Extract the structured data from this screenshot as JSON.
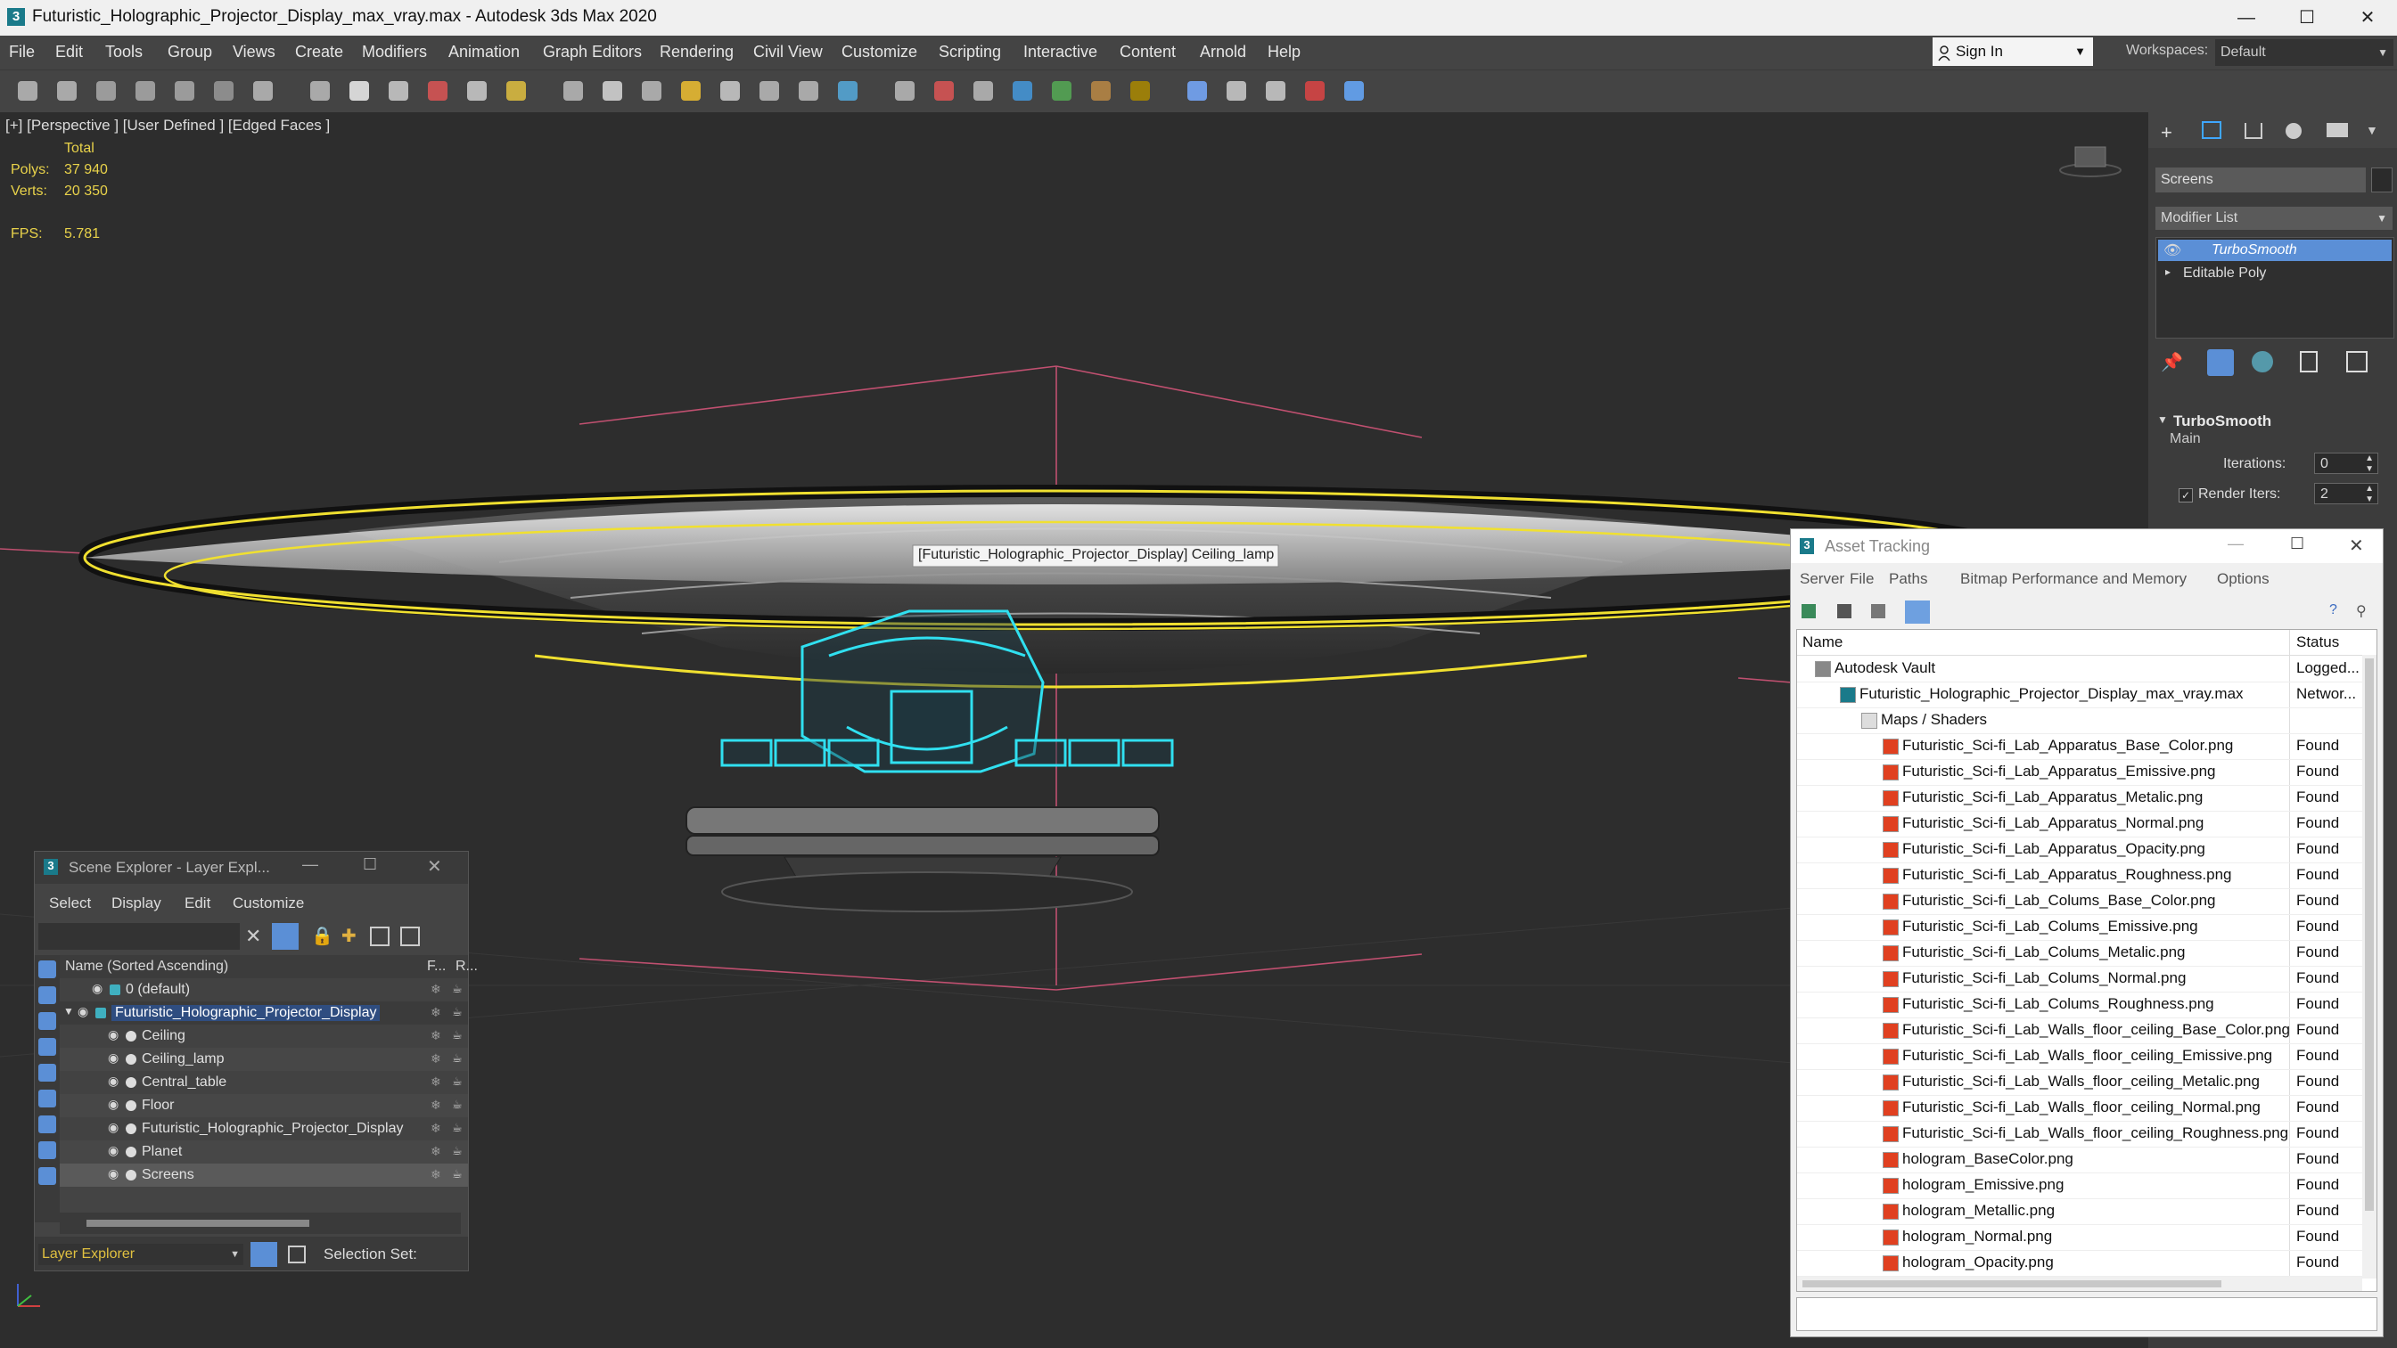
{
  "window": {
    "title": "Futuristic_Holographic_Projector_Display_max_vray.max - Autodesk 3ds Max 2020",
    "app_icon": "3",
    "minimize": "—",
    "maximize": "☐",
    "close": "✕"
  },
  "menu": [
    "File",
    "Edit",
    "Tools",
    "Group",
    "Views",
    "Create",
    "Modifiers",
    "Animation",
    "Graph Editors",
    "Rendering",
    "Civil View",
    "Customize",
    "Scripting",
    "Interactive",
    "Content",
    "Arnold",
    "Help"
  ],
  "signin": {
    "label": "Sign In"
  },
  "workspace": {
    "label": "Workspaces:",
    "value": "Default"
  },
  "viewport": {
    "label": "[+] [Perspective ] [User Defined ] [Edged Faces ]",
    "stats": {
      "total_label": "Total",
      "polys_label": "Polys:",
      "polys": "37 940",
      "verts_label": "Verts:",
      "verts": "20 350",
      "fps_label": "FPS:",
      "fps": "5.781"
    },
    "tooltip": "[Futuristic_Holographic_Projector_Display] Ceiling_lamp"
  },
  "command_panel": {
    "object_name": "Screens",
    "modifier_list": "Modifier List",
    "stack": [
      "TurboSmooth",
      "Editable Poly"
    ],
    "rollout_title": "TurboSmooth",
    "section": "Main",
    "iterations_label": "Iterations:",
    "iterations": "0",
    "render_iters_label": "Render Iters:",
    "render_iters": "2"
  },
  "scene_explorer": {
    "title": "Scene Explorer - Layer Expl...",
    "menu": [
      "Select",
      "Display",
      "Edit",
      "Customize"
    ],
    "col_name": "Name (Sorted Ascending)",
    "col_f": "F...",
    "col_r": "R...",
    "rows": [
      {
        "label": "0 (default)",
        "indent": 1
      },
      {
        "label": "Futuristic_Holographic_Projector_Display",
        "indent": 0,
        "selected": true
      },
      {
        "label": "Ceiling",
        "indent": 2
      },
      {
        "label": "Ceiling_lamp",
        "indent": 2
      },
      {
        "label": "Central_table",
        "indent": 2
      },
      {
        "label": "Floor",
        "indent": 2
      },
      {
        "label": "Futuristic_Holographic_Projector_Display",
        "indent": 2
      },
      {
        "label": "Planet",
        "indent": 2
      },
      {
        "label": "Screens",
        "indent": 2,
        "highlight": true
      }
    ],
    "footer_select": "Layer Explorer",
    "selection_set_label": "Selection Set:"
  },
  "asset_tracking": {
    "title": "Asset Tracking",
    "menu": [
      "Server",
      "File",
      "Paths",
      "Bitmap Performance and Memory",
      "Options"
    ],
    "col_name": "Name",
    "col_status": "Status",
    "rows": [
      {
        "name": "Autodesk Vault",
        "status": "Logged...",
        "indent": 0,
        "icon": "vault"
      },
      {
        "name": "Futuristic_Holographic_Projector_Display_max_vray.max",
        "status": "Networ...",
        "indent": 1,
        "icon": "max"
      },
      {
        "name": "Maps / Shaders",
        "status": "",
        "indent": 2,
        "icon": "folder"
      },
      {
        "name": "Futuristic_Sci-fi_Lab_Apparatus_Base_Color.png",
        "status": "Found",
        "indent": 3,
        "icon": "png"
      },
      {
        "name": "Futuristic_Sci-fi_Lab_Apparatus_Emissive.png",
        "status": "Found",
        "indent": 3,
        "icon": "png"
      },
      {
        "name": "Futuristic_Sci-fi_Lab_Apparatus_Metalic.png",
        "status": "Found",
        "indent": 3,
        "icon": "png"
      },
      {
        "name": "Futuristic_Sci-fi_Lab_Apparatus_Normal.png",
        "status": "Found",
        "indent": 3,
        "icon": "png"
      },
      {
        "name": "Futuristic_Sci-fi_Lab_Apparatus_Opacity.png",
        "status": "Found",
        "indent": 3,
        "icon": "png"
      },
      {
        "name": "Futuristic_Sci-fi_Lab_Apparatus_Roughness.png",
        "status": "Found",
        "indent": 3,
        "icon": "png"
      },
      {
        "name": "Futuristic_Sci-fi_Lab_Colums_Base_Color.png",
        "status": "Found",
        "indent": 3,
        "icon": "png"
      },
      {
        "name": "Futuristic_Sci-fi_Lab_Colums_Emissive.png",
        "status": "Found",
        "indent": 3,
        "icon": "png"
      },
      {
        "name": "Futuristic_Sci-fi_Lab_Colums_Metalic.png",
        "status": "Found",
        "indent": 3,
        "icon": "png"
      },
      {
        "name": "Futuristic_Sci-fi_Lab_Colums_Normal.png",
        "status": "Found",
        "indent": 3,
        "icon": "png"
      },
      {
        "name": "Futuristic_Sci-fi_Lab_Colums_Roughness.png",
        "status": "Found",
        "indent": 3,
        "icon": "png"
      },
      {
        "name": "Futuristic_Sci-fi_Lab_Walls_floor_ceiling_Base_Color.png",
        "status": "Found",
        "indent": 3,
        "icon": "png"
      },
      {
        "name": "Futuristic_Sci-fi_Lab_Walls_floor_ceiling_Emissive.png",
        "status": "Found",
        "indent": 3,
        "icon": "png"
      },
      {
        "name": "Futuristic_Sci-fi_Lab_Walls_floor_ceiling_Metalic.png",
        "status": "Found",
        "indent": 3,
        "icon": "png"
      },
      {
        "name": "Futuristic_Sci-fi_Lab_Walls_floor_ceiling_Normal.png",
        "status": "Found",
        "indent": 3,
        "icon": "png"
      },
      {
        "name": "Futuristic_Sci-fi_Lab_Walls_floor_ceiling_Roughness.png",
        "status": "Found",
        "indent": 3,
        "icon": "png"
      },
      {
        "name": "hologram_BaseColor.png",
        "status": "Found",
        "indent": 3,
        "icon": "png"
      },
      {
        "name": "hologram_Emissive.png",
        "status": "Found",
        "indent": 3,
        "icon": "png"
      },
      {
        "name": "hologram_Metallic.png",
        "status": "Found",
        "indent": 3,
        "icon": "png"
      },
      {
        "name": "hologram_Normal.png",
        "status": "Found",
        "indent": 3,
        "icon": "png"
      },
      {
        "name": "hologram_Opacity.png",
        "status": "Found",
        "indent": 3,
        "icon": "png"
      }
    ]
  },
  "colors": {
    "accent": "#4a90d9",
    "selection_yellow": "#f0e030",
    "hologram_cyan": "#30e0f0",
    "stats_yellow": "#e8d24a"
  }
}
